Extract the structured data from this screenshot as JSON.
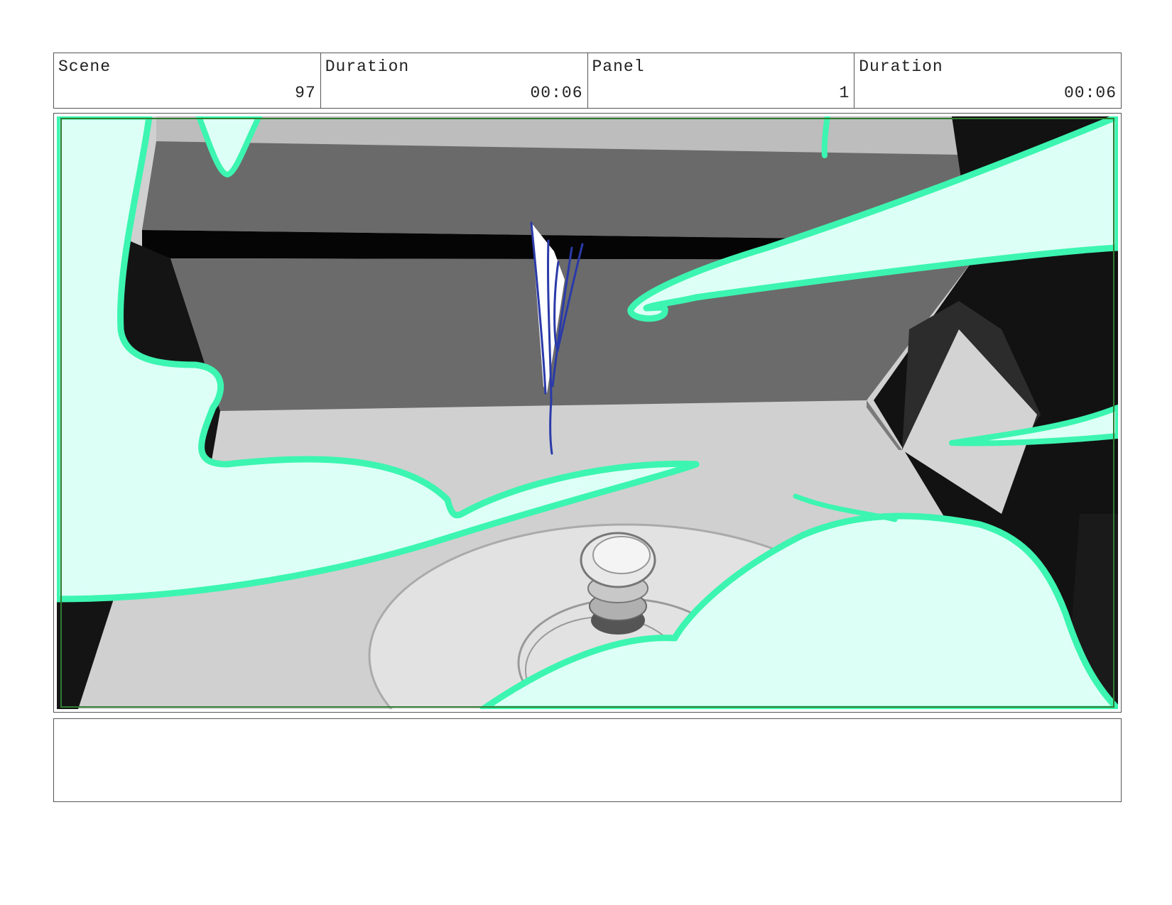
{
  "header": {
    "scene_label": "Scene",
    "scene_value": "97",
    "scene_duration_label": "Duration",
    "scene_duration_value": "00:06",
    "panel_label": "Panel",
    "panel_value": "1",
    "panel_duration_label": "Duration",
    "panel_duration_value": "00:06"
  },
  "notes": {
    "text": ""
  },
  "colors": {
    "effect_outline": "#3cf5b0",
    "effect_fill": "#dcfff6",
    "safe_frame": "#2e7d32",
    "sketch_stroke": "#2a3aa8"
  }
}
